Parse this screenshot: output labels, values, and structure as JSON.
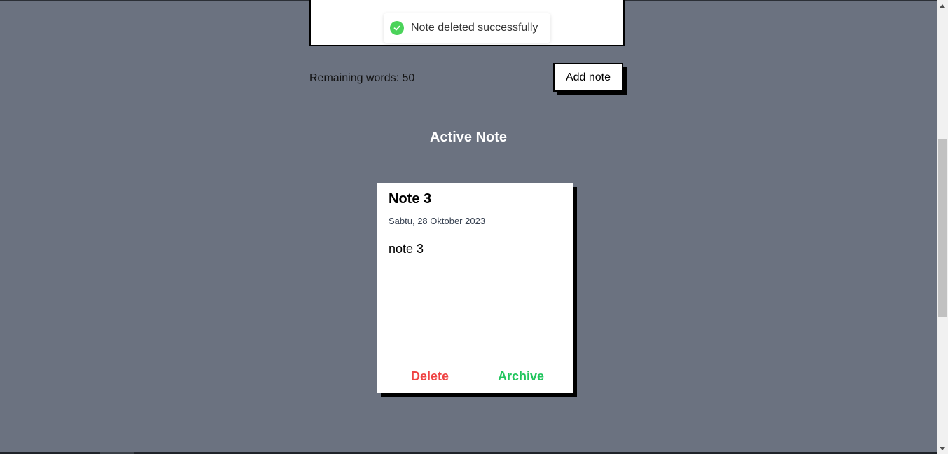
{
  "toast": {
    "icon": "check-circle-icon",
    "message": "Note deleted successfully",
    "icon_color": "#4bd35a"
  },
  "form": {
    "remaining_words": "Remaining words: 50",
    "add_button_label": "Add note"
  },
  "section": {
    "title": "Active Note"
  },
  "notes": [
    {
      "title": "Note 3",
      "date": "Sabtu, 28 Oktober 2023",
      "body": "note 3",
      "delete_label": "Delete",
      "archive_label": "Archive"
    }
  ],
  "colors": {
    "background": "#6b7280",
    "delete": "#ef4444",
    "archive": "#22c55e"
  },
  "scrollbar": {
    "up_icon": "scroll-up-arrow-icon",
    "down_icon": "scroll-down-arrow-icon"
  }
}
